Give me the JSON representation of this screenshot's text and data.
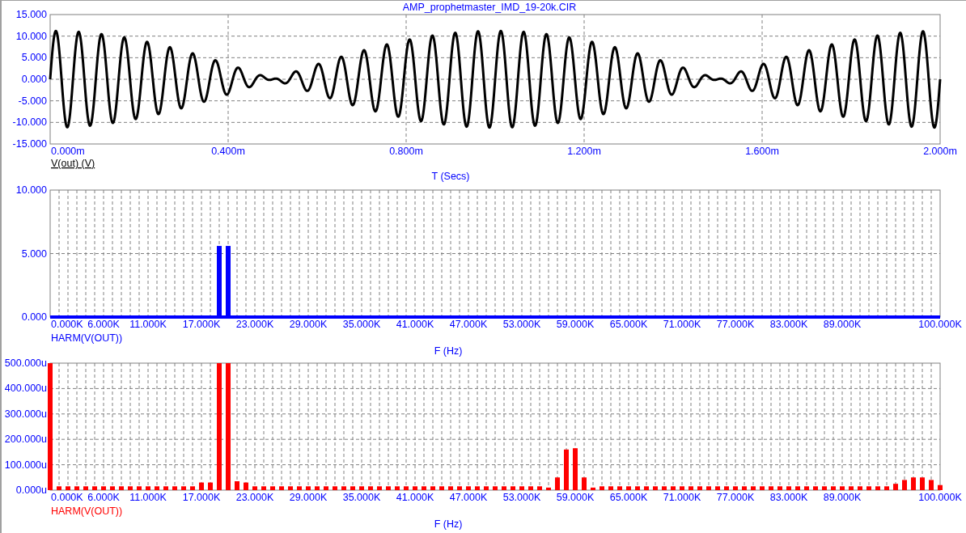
{
  "time_plot": {
    "title": "AMP_prophetmaster_IMD_19-20k.CIR",
    "y_tick_labels": [
      "15.000",
      "10.000",
      "5.000",
      "0.000",
      "-5.000",
      "-10.000",
      "-15.000"
    ],
    "x_tick_labels": [
      "0.000m",
      "0.400m",
      "0.800m",
      "1.200m",
      "1.600m",
      "2.000m"
    ],
    "trace_label": "V(out) (V)",
    "x_axis_title": "T (Secs)"
  },
  "spectrum_plots": [
    {
      "chart_data": {
        "type": "bar",
        "grid": true,
        "xlabel": "F (Hz)",
        "xlim": [
          0,
          100
        ],
        "ylim": [
          0,
          10
        ],
        "xticks": [
          {
            "value": 0,
            "label": "0.000K"
          },
          {
            "value": 6,
            "label": "6.000K"
          },
          {
            "value": 11,
            "label": "11.000K"
          },
          {
            "value": 17,
            "label": "17.000K"
          },
          {
            "value": 23,
            "label": "23.000K"
          },
          {
            "value": 29,
            "label": "29.000K"
          },
          {
            "value": 35,
            "label": "35.000K"
          },
          {
            "value": 41,
            "label": "41.000K"
          },
          {
            "value": 47,
            "label": "47.000K"
          },
          {
            "value": 53,
            "label": "53.000K"
          },
          {
            "value": 59,
            "label": "59.000K"
          },
          {
            "value": 65,
            "label": "65.000K"
          },
          {
            "value": 71,
            "label": "71.000K"
          },
          {
            "value": 77,
            "label": "77.000K"
          },
          {
            "value": 83,
            "label": "83.000K"
          },
          {
            "value": 89,
            "label": "89.000K"
          },
          {
            "value": 100,
            "label": "100.000K"
          }
        ],
        "yticks": [
          {
            "value": 0,
            "label": "0.000"
          },
          {
            "value": 5,
            "label": "5.000"
          },
          {
            "value": 10,
            "label": "10.000"
          }
        ],
        "x": [
          0,
          1,
          2,
          3,
          4,
          5,
          6,
          7,
          8,
          9,
          10,
          11,
          12,
          13,
          14,
          15,
          16,
          17,
          18,
          19,
          20,
          21,
          22,
          23,
          24,
          25,
          26,
          27,
          28,
          29,
          30,
          31,
          32,
          33,
          34,
          35,
          36,
          37,
          38,
          39,
          40,
          41,
          42,
          43,
          44,
          45,
          46,
          47,
          48,
          49,
          50,
          51,
          52,
          53,
          54,
          55,
          56,
          57,
          58,
          59,
          60,
          61,
          62,
          63,
          64,
          65,
          66,
          67,
          68,
          69,
          70,
          71,
          72,
          73,
          74,
          75,
          76,
          77,
          78,
          79,
          80,
          81,
          82,
          83,
          84,
          85,
          86,
          87,
          88,
          89,
          90,
          91,
          92,
          93,
          94,
          95,
          96,
          97,
          98,
          99,
          100
        ],
        "series": [
          {
            "name": "HARM(V(OUT))",
            "color": "#0000ff",
            "values": [
              0,
              0,
              0,
              0,
              0,
              0,
              0,
              0,
              0,
              0,
              0,
              0,
              0,
              0,
              0,
              0,
              0,
              0,
              0,
              5.6,
              5.6,
              0,
              0,
              0,
              0,
              0,
              0,
              0,
              0,
              0,
              0,
              0,
              0,
              0,
              0,
              0,
              0,
              0,
              0,
              0,
              0,
              0,
              0,
              0,
              0,
              0,
              0,
              0,
              0,
              0,
              0,
              0,
              0,
              0,
              0,
              0,
              0,
              0,
              0,
              0,
              0,
              0,
              0,
              0,
              0,
              0,
              0,
              0,
              0,
              0,
              0,
              0,
              0,
              0,
              0,
              0,
              0,
              0,
              0,
              0,
              0,
              0,
              0,
              0,
              0,
              0,
              0,
              0,
              0,
              0,
              0,
              0,
              0,
              0,
              0,
              0,
              0,
              0,
              0,
              0,
              0
            ]
          }
        ]
      }
    },
    {
      "chart_data": {
        "type": "bar",
        "grid": true,
        "xlabel": "F (Hz)",
        "xlim": [
          0,
          100
        ],
        "ylim": [
          0,
          500
        ],
        "xticks": [
          {
            "value": 0,
            "label": "0.000K"
          },
          {
            "value": 6,
            "label": "6.000K"
          },
          {
            "value": 11,
            "label": "11.000K"
          },
          {
            "value": 17,
            "label": "17.000K"
          },
          {
            "value": 23,
            "label": "23.000K"
          },
          {
            "value": 29,
            "label": "29.000K"
          },
          {
            "value": 35,
            "label": "35.000K"
          },
          {
            "value": 41,
            "label": "41.000K"
          },
          {
            "value": 47,
            "label": "47.000K"
          },
          {
            "value": 53,
            "label": "53.000K"
          },
          {
            "value": 59,
            "label": "59.000K"
          },
          {
            "value": 65,
            "label": "65.000K"
          },
          {
            "value": 71,
            "label": "71.000K"
          },
          {
            "value": 77,
            "label": "77.000K"
          },
          {
            "value": 83,
            "label": "83.000K"
          },
          {
            "value": 89,
            "label": "89.000K"
          },
          {
            "value": 100,
            "label": "100.000K"
          }
        ],
        "yticks": [
          {
            "value": 0,
            "label": "0.000u"
          },
          {
            "value": 100,
            "label": "100.000u"
          },
          {
            "value": 200,
            "label": "200.000u"
          },
          {
            "value": 300,
            "label": "300.000u"
          },
          {
            "value": 400,
            "label": "400.000u"
          },
          {
            "value": 500,
            "label": "500.000u"
          }
        ],
        "x": [
          0,
          1,
          2,
          3,
          4,
          5,
          6,
          7,
          8,
          9,
          10,
          11,
          12,
          13,
          14,
          15,
          16,
          17,
          18,
          19,
          20,
          21,
          22,
          23,
          24,
          25,
          26,
          27,
          28,
          29,
          30,
          31,
          32,
          33,
          34,
          35,
          36,
          37,
          38,
          39,
          40,
          41,
          42,
          43,
          44,
          45,
          46,
          47,
          48,
          49,
          50,
          51,
          52,
          53,
          54,
          55,
          56,
          57,
          58,
          59,
          60,
          61,
          62,
          63,
          64,
          65,
          66,
          67,
          68,
          69,
          70,
          71,
          72,
          73,
          74,
          75,
          76,
          77,
          78,
          79,
          80,
          81,
          82,
          83,
          84,
          85,
          86,
          87,
          88,
          89,
          90,
          91,
          92,
          93,
          94,
          95,
          96,
          97,
          98,
          99,
          100
        ],
        "series": [
          {
            "name": "HARM(V(OUT))",
            "color": "#ff0000",
            "values": [
              500,
              15,
              15,
              15,
              15,
              15,
              15,
              15,
              15,
              15,
              15,
              15,
              15,
              15,
              15,
              15,
              15,
              30,
              30,
              500,
              500,
              35,
              30,
              15,
              15,
              15,
              15,
              15,
              15,
              15,
              15,
              15,
              15,
              15,
              15,
              15,
              15,
              15,
              15,
              15,
              15,
              15,
              15,
              15,
              15,
              15,
              15,
              15,
              15,
              15,
              15,
              15,
              15,
              15,
              15,
              15,
              10,
              50,
              160,
              165,
              50,
              10,
              15,
              15,
              15,
              15,
              15,
              15,
              15,
              15,
              15,
              15,
              15,
              15,
              15,
              15,
              15,
              15,
              15,
              15,
              15,
              15,
              15,
              15,
              15,
              15,
              15,
              15,
              15,
              15,
              15,
              15,
              15,
              15,
              15,
              25,
              40,
              50,
              50,
              40,
              20
            ]
          }
        ]
      }
    }
  ]
}
